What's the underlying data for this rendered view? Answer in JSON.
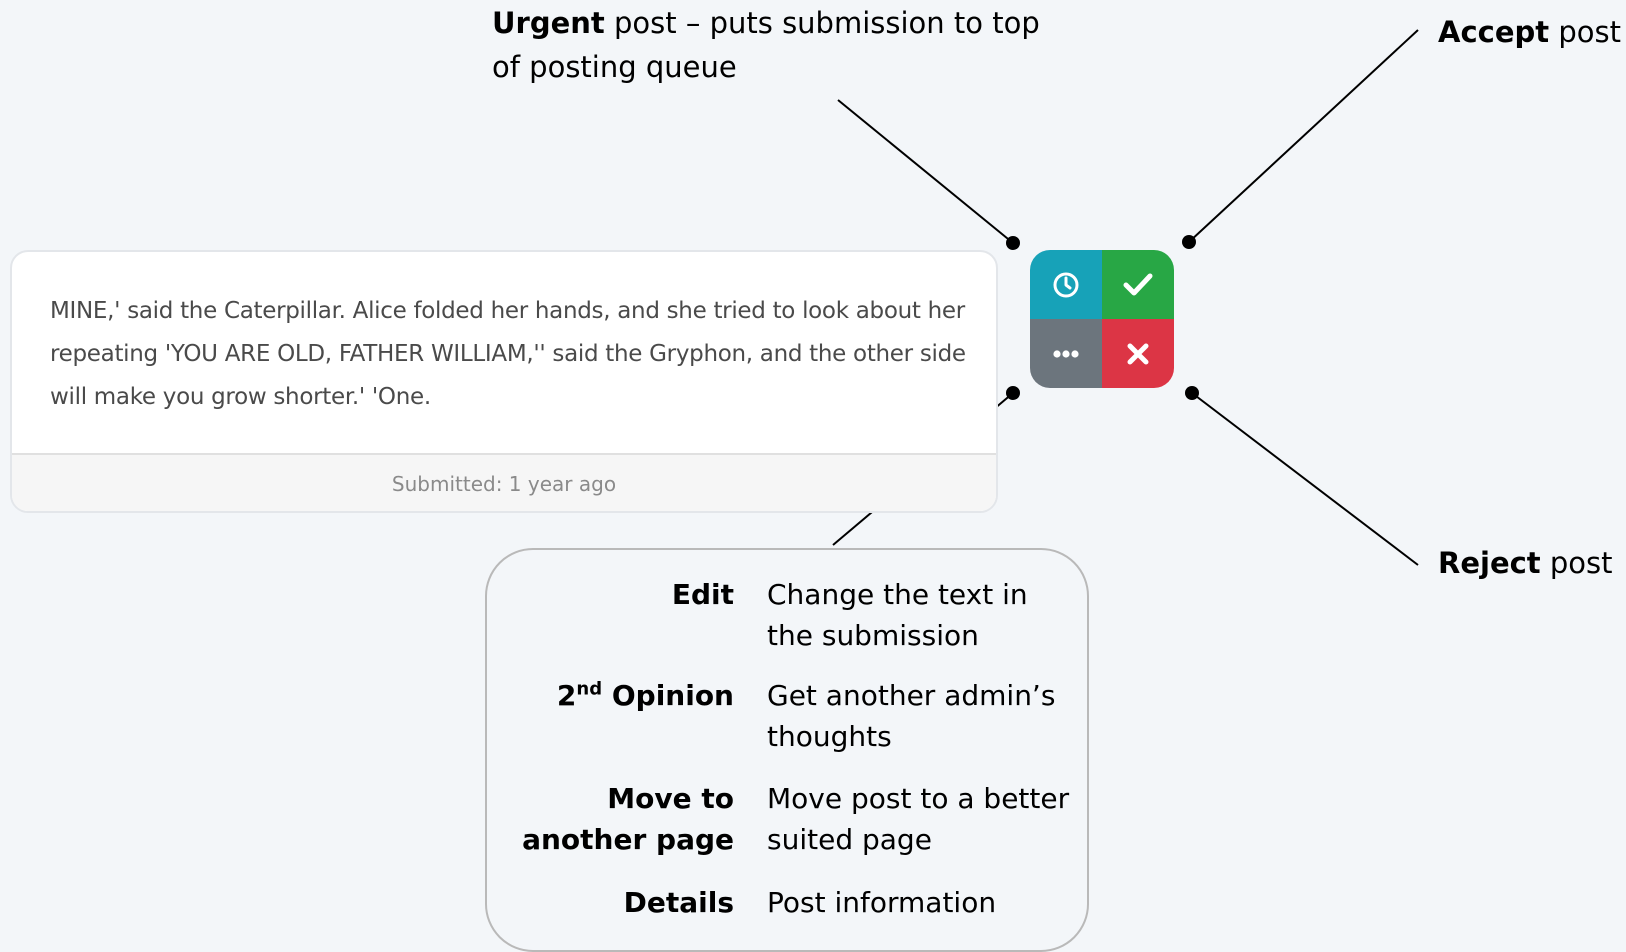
{
  "callouts": {
    "urgent_bold": "Urgent",
    "urgent_text": " post – puts submission to top of posting queue",
    "accept_bold": "Accept",
    "accept_text": " post",
    "reject_bold": "Reject",
    "reject_text": " post"
  },
  "post": {
    "body": "MINE,' said the Caterpillar. Alice folded her hands, and she tried to look about her repeating 'YOU ARE OLD, FATHER WILLIAM,'' said the Gryphon, and the other side will make you grow shorter.' 'One.",
    "footer": "Submitted: 1 year ago"
  },
  "actions": {
    "urgent_icon": "clock-icon",
    "accept_icon": "check-icon",
    "more_icon": "ellipsis-icon",
    "reject_icon": "close-icon",
    "colors": {
      "urgent": "#17a2b8",
      "accept": "#28a745",
      "more": "#6c757d",
      "reject": "#dc3545"
    }
  },
  "more_menu": {
    "items": [
      {
        "term": "Edit",
        "description": "Change the text in the submission"
      },
      {
        "term_prefix": "2",
        "term_sup": "nd",
        "term_suffix": " Opinion",
        "description": "Get another admin’s thoughts"
      },
      {
        "term": "Move to another page",
        "description": "Move post to a better suited page"
      },
      {
        "term": "Details",
        "description": "Post information"
      }
    ]
  }
}
